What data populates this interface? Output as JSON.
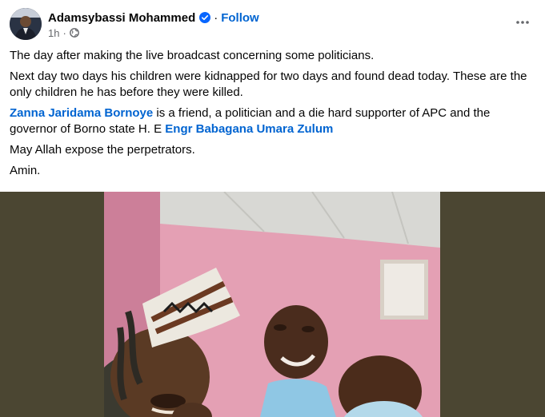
{
  "post": {
    "author": "Adamsybassi Mohammed",
    "separator": "·",
    "follow_label": "Follow",
    "time": "1h",
    "meta_sep": "·",
    "paragraphs": {
      "p1": "The day after making the live broadcast concerning some politicians.",
      "p2": "Next day two days his children were kidnapped for two days and found dead today. These are the only children he has before they were killed.",
      "p3_mention": "Zanna Jaridama Bornoye",
      "p3_text": " is a friend, a politician and a die hard supporter of APC and the governor of Borno state H. E ",
      "p3_mention2": "Engr Babagana Umara Zulum",
      "p4": "May Allah expose  the perpetrators.",
      "p5": "Amin."
    }
  },
  "icons": {
    "verified": "verified-badge-icon",
    "audience": "globe-icon",
    "more": "more-options-icon"
  },
  "colors": {
    "link": "#0064d1",
    "verified": "#0866ff",
    "photo_backdrop": "#4b4632"
  }
}
